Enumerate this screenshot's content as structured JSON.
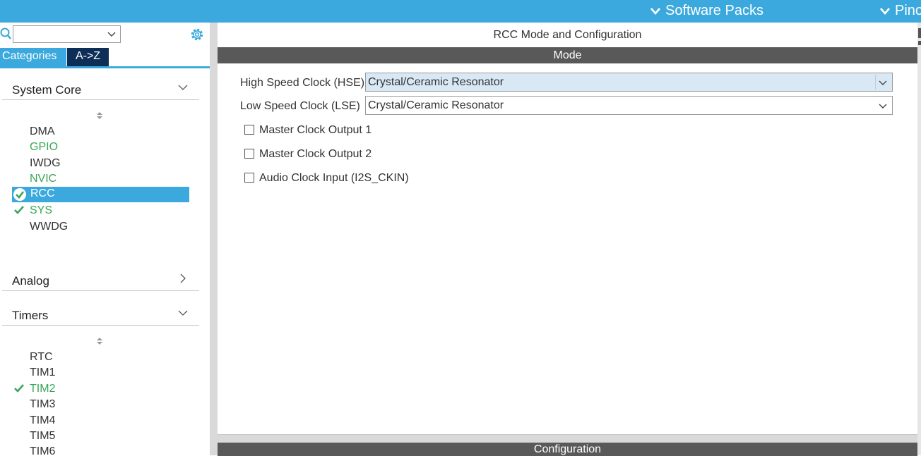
{
  "colors": {
    "accent": "#3ba9dd",
    "dark_tab": "#0d2f57",
    "header_bar": "#595959",
    "green": "#3aa657"
  },
  "topbar": {
    "software_packs": "Software Packs",
    "pinout": "Pinout"
  },
  "left": {
    "search_value": "",
    "tabs": {
      "categories": "Categories",
      "az": "A->Z"
    },
    "system_core": {
      "title": "System Core",
      "items": [
        "DMA",
        "GPIO",
        "IWDG",
        "NVIC",
        "RCC",
        "SYS",
        "WWDG"
      ]
    },
    "analog": {
      "title": "Analog"
    },
    "timers": {
      "title": "Timers",
      "items": [
        "RTC",
        "TIM1",
        "TIM2",
        "TIM3",
        "TIM4",
        "TIM5",
        "TIM6"
      ]
    }
  },
  "main": {
    "title": "RCC Mode and Configuration",
    "mode_header": "Mode",
    "hse": {
      "label": "High Speed Clock (HSE)",
      "value": "Crystal/Ceramic Resonator"
    },
    "lse": {
      "label": "Low Speed Clock (LSE)",
      "value": "Crystal/Ceramic Resonator"
    },
    "checkboxes": [
      "Master Clock Output 1",
      "Master Clock Output 2",
      "Audio Clock Input (I2S_CKIN)"
    ],
    "config_header": "Configuration"
  }
}
